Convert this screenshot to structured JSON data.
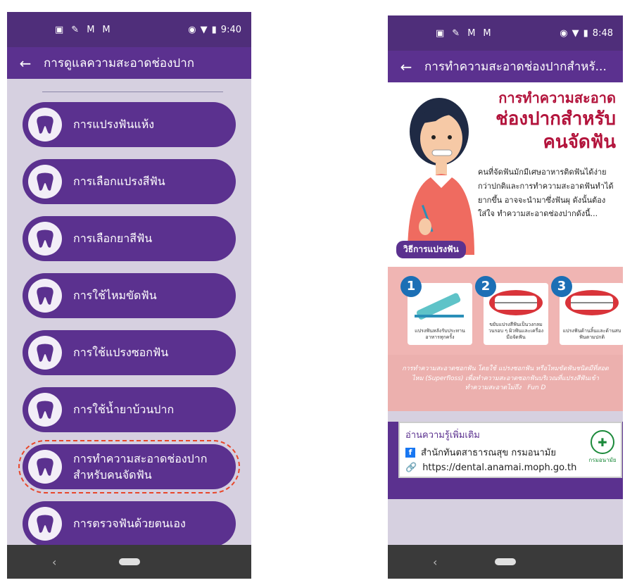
{
  "left": {
    "status": {
      "icons": [
        "sim-icon",
        "pen-icon",
        "mail-icon",
        "mail-icon"
      ],
      "time": "9:40"
    },
    "appbar": {
      "back": "←",
      "title": "การดูแลความสะอาดช่องปาก"
    },
    "menu": [
      {
        "label": "การแปรงฟันแห้ง"
      },
      {
        "label": "การเลือกแปรงสีฟัน"
      },
      {
        "label": "การเลือกยาสีฟัน"
      },
      {
        "label": "การใช้ไหมขัดฟัน"
      },
      {
        "label": "การใช้แปรงซอกฟัน"
      },
      {
        "label": "การใช้น้ำยาบ้วนปาก"
      },
      {
        "label": "การทำความสะอาดช่องปาก\nสำหรับคนจัดฟัน",
        "highlighted": true
      },
      {
        "label": "การตรวจฟันด้วยตนเอง"
      }
    ],
    "nav": {
      "back": "‹"
    }
  },
  "right": {
    "status": {
      "time": "8:48"
    },
    "appbar": {
      "back": "←",
      "title": "การทำความสะอาดช่องปากสำหรั..."
    },
    "poster": {
      "title_line1": "การทำความสะอาด",
      "title_line2": "ช่องปากสำหรับ",
      "title_line3": "คนจัดฟัน",
      "body": "คนที่จัดฟันมักมีเศษอาหารติดฟันได้ง่ายกว่าปกติและการทำความสะอาดฟันทำได้ยากขึ้น อาจจะนำมาซึ่งฟันผุ ดังนั้นต้องใส่ใจ ทำความสะอาดช่องปากดังนี้...",
      "method_tag": "วิธีการแปรงฟัน",
      "steps": [
        {
          "num": "1",
          "caption": "แปรงฟันหลังรับประทานอาหารทุกครั้ง"
        },
        {
          "num": "2",
          "caption": "ขยับแปรงสีฟันเป็นวงกลม วนรอบ ๆ ผิวฟันและเครื่องมือจัดฟัน"
        },
        {
          "num": "3",
          "caption": "แปรงฟันด้านลิ้นและด้านสบฟันตามปกติ"
        }
      ],
      "footnote": "การทำความสะอาดซอกฟัน โดยใช้ แปรงซอกฟัน หรือไหมขัดฟันชนิดมีที่สอดไหม (Superfloss) เพื่อทำความสะอาดซอกฟันบริเวณที่แปรงสีฟันเข้าทำความสะอาดไม่ถึง",
      "brand": "Fun D"
    },
    "readmore": {
      "title": "อ่านความรู้เพิ่มเติม",
      "facebook": "สำนักทันตสาธารณสุข กรมอนามัย",
      "link": "https://dental.anamai.moph.go.th",
      "org": "กรมอนามัย"
    },
    "nav": {
      "back": "‹"
    }
  }
}
